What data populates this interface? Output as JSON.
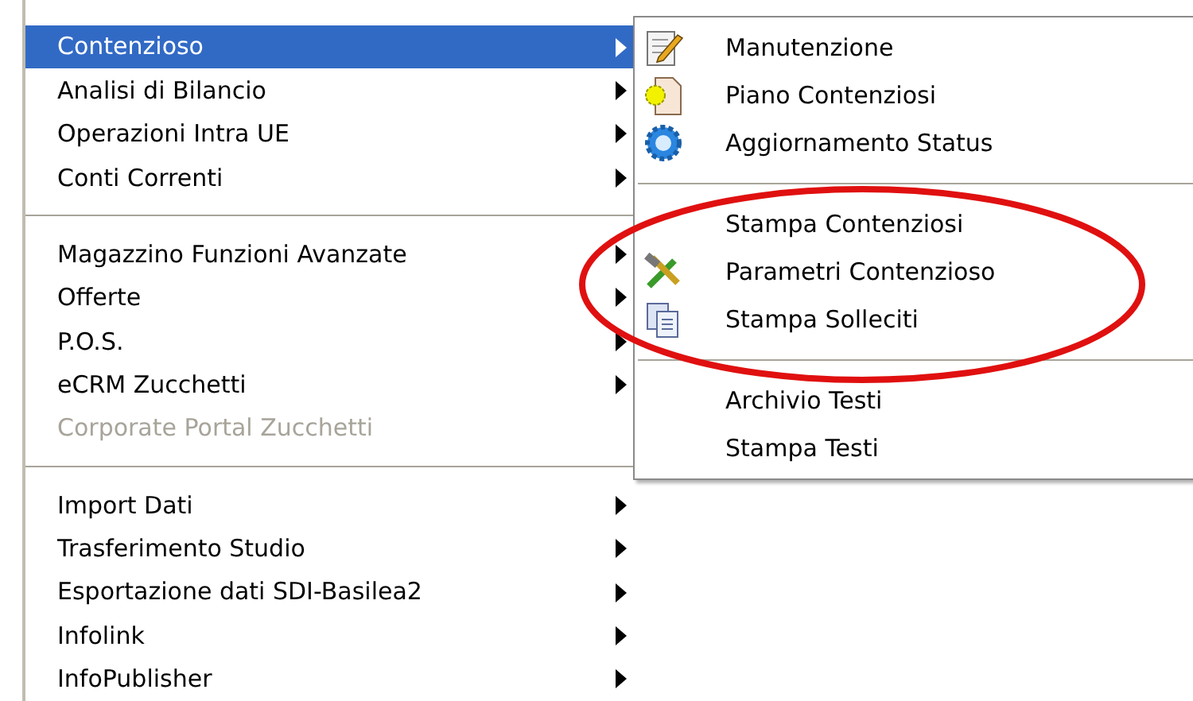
{
  "menu": {
    "items": [
      {
        "kind": "item",
        "label": "Contenzioso",
        "selected": true,
        "disabled": false,
        "has_submenu": true
      },
      {
        "kind": "item",
        "label": "Analisi di Bilancio",
        "selected": false,
        "disabled": false,
        "has_submenu": true
      },
      {
        "kind": "item",
        "label": "Operazioni Intra UE",
        "selected": false,
        "disabled": false,
        "has_submenu": true
      },
      {
        "kind": "item",
        "label": "Conti Correnti",
        "selected": false,
        "disabled": false,
        "has_submenu": true
      },
      {
        "kind": "separator"
      },
      {
        "kind": "item",
        "label": "Magazzino Funzioni Avanzate",
        "selected": false,
        "disabled": false,
        "has_submenu": true
      },
      {
        "kind": "item",
        "label": "Offerte",
        "selected": false,
        "disabled": false,
        "has_submenu": true
      },
      {
        "kind": "item",
        "label": "P.O.S.",
        "selected": false,
        "disabled": false,
        "has_submenu": true
      },
      {
        "kind": "item",
        "label": "eCRM Zucchetti",
        "selected": false,
        "disabled": false,
        "has_submenu": true
      },
      {
        "kind": "item",
        "label": "Corporate Portal Zucchetti",
        "selected": false,
        "disabled": true,
        "has_submenu": false
      },
      {
        "kind": "separator"
      },
      {
        "kind": "item",
        "label": "Import Dati",
        "selected": false,
        "disabled": false,
        "has_submenu": true
      },
      {
        "kind": "item",
        "label": "Trasferimento Studio",
        "selected": false,
        "disabled": false,
        "has_submenu": true
      },
      {
        "kind": "item",
        "label": "Esportazione dati SDI-Basilea2",
        "selected": false,
        "disabled": false,
        "has_submenu": true
      },
      {
        "kind": "item",
        "label": "Infolink",
        "selected": false,
        "disabled": false,
        "has_submenu": true
      },
      {
        "kind": "item",
        "label": "InfoPublisher",
        "selected": false,
        "disabled": false,
        "has_submenu": true
      }
    ]
  },
  "submenu": {
    "items": [
      {
        "kind": "edit",
        "label": "Manutenzione"
      },
      {
        "kind": "newdoc",
        "label": "Piano Contenziosi"
      },
      {
        "kind": "gear",
        "label": "Aggiornamento Status"
      },
      {
        "kind": "separator"
      },
      {
        "kind": "plain",
        "label": "Stampa Contenziosi"
      },
      {
        "kind": "tools",
        "label": "Parametri Contenzioso"
      },
      {
        "kind": "copy",
        "label": "Stampa Solleciti"
      },
      {
        "kind": "separator"
      },
      {
        "kind": "plain",
        "label": "Archivio Testi"
      },
      {
        "kind": "plain",
        "label": "Stampa Testi"
      }
    ]
  }
}
